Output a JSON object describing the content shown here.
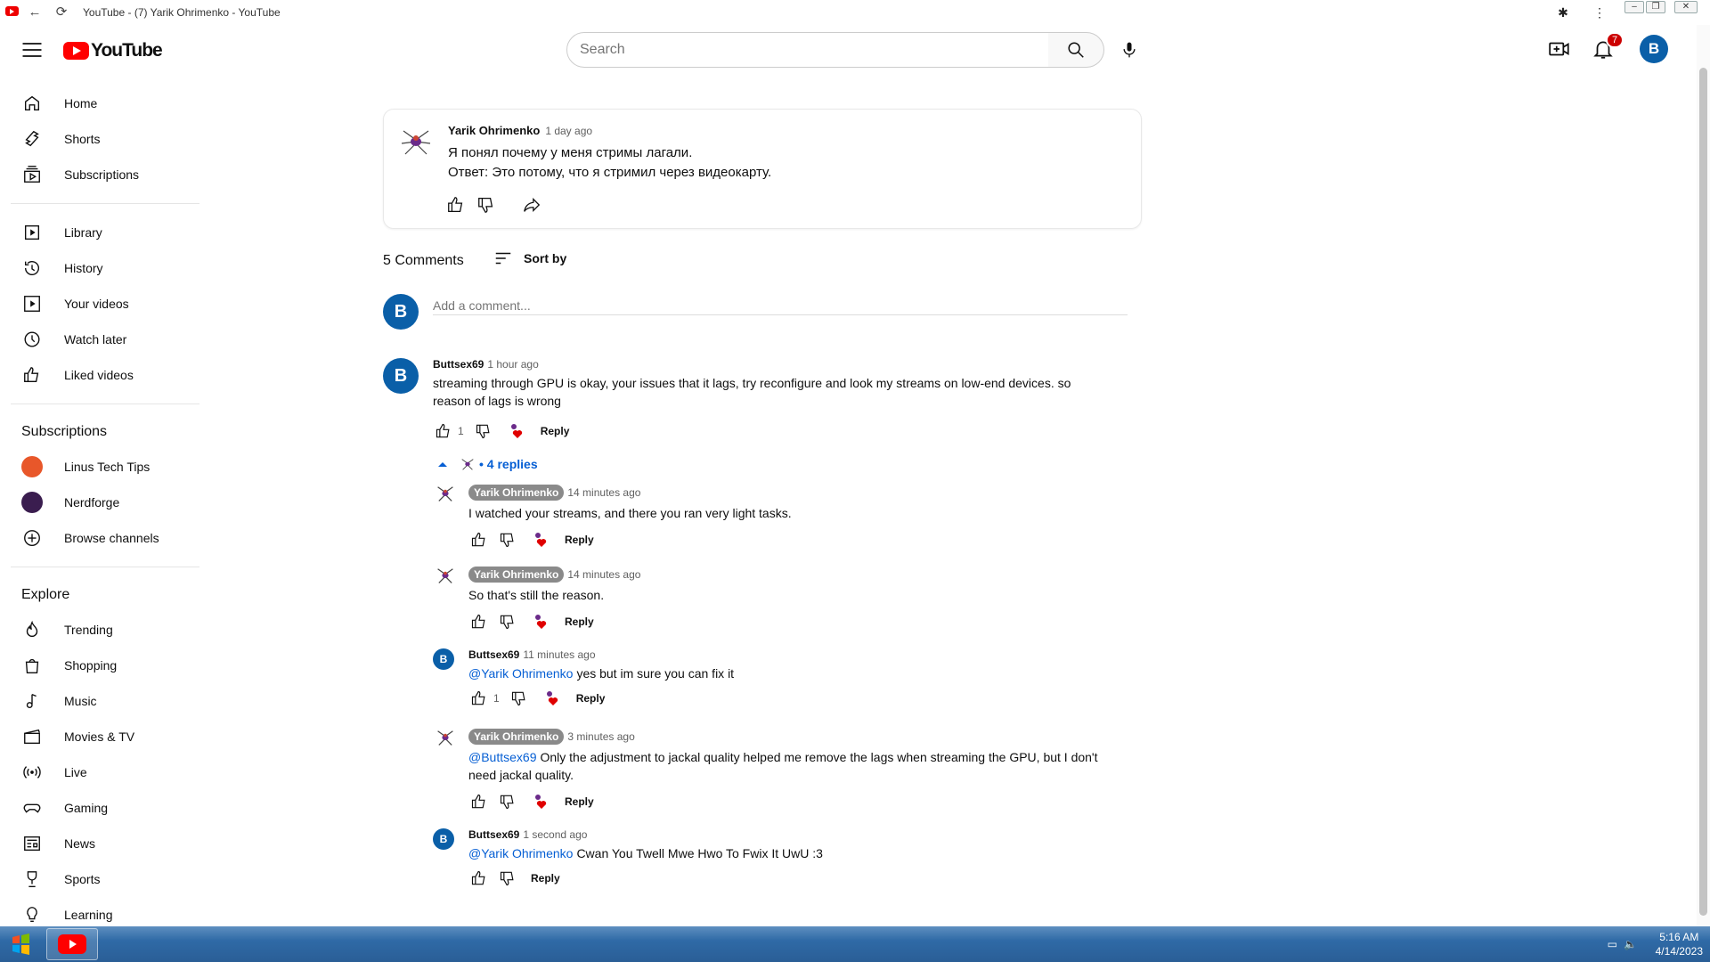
{
  "window": {
    "title": "YouTube - (7) Yarik Ohrimenko - YouTube"
  },
  "masthead": {
    "logo_text": "YouTube",
    "search_placeholder": "Search",
    "notification_count": "7",
    "avatar_letter": "B"
  },
  "sidebar": {
    "main": [
      {
        "label": "Home",
        "icon": "home-icon"
      },
      {
        "label": "Shorts",
        "icon": "shorts-icon"
      },
      {
        "label": "Subscriptions",
        "icon": "subscriptions-icon"
      }
    ],
    "library": [
      {
        "label": "Library",
        "icon": "library-icon"
      },
      {
        "label": "History",
        "icon": "history-icon"
      },
      {
        "label": "Your videos",
        "icon": "your-videos-icon"
      },
      {
        "label": "Watch later",
        "icon": "watch-later-icon"
      },
      {
        "label": "Liked videos",
        "icon": "liked-videos-icon"
      }
    ],
    "subscriptions_heading": "Subscriptions",
    "subscriptions": [
      {
        "label": "Linus Tech Tips",
        "color": "#e8572a"
      },
      {
        "label": "Nerdforge",
        "color": "#3a1d4f"
      },
      {
        "label": "Browse channels",
        "icon": "plus-circle-icon"
      }
    ],
    "explore_heading": "Explore",
    "explore": [
      {
        "label": "Trending",
        "icon": "trending-icon"
      },
      {
        "label": "Shopping",
        "icon": "shopping-icon"
      },
      {
        "label": "Music",
        "icon": "music-icon"
      },
      {
        "label": "Movies & TV",
        "icon": "movies-icon"
      },
      {
        "label": "Live",
        "icon": "live-icon"
      },
      {
        "label": "Gaming",
        "icon": "gaming-icon"
      },
      {
        "label": "News",
        "icon": "news-icon"
      },
      {
        "label": "Sports",
        "icon": "sports-icon"
      },
      {
        "label": "Learning",
        "icon": "learning-icon"
      }
    ]
  },
  "post": {
    "author": "Yarik Ohrimenko",
    "time": "1 day ago",
    "line1": "Я понял почему у меня стримы лагали.",
    "line2": "Ответ: Это потому, что я стримил через видеокарту."
  },
  "comments_header": {
    "count": "5 Comments",
    "sort_label": "Sort by",
    "add_placeholder": "Add a comment...",
    "avatar_letter": "B"
  },
  "top_comment": {
    "author": "Buttsex69",
    "time": "1 hour ago",
    "text_line1": "streaming through GPU is okay, your issues that it lags, try reconfigure and look my streams on low-end devices. so",
    "text_line2": "reason of lags is wrong",
    "likes": "1",
    "reply_label": "Reply",
    "replies_toggle": "• 4 replies"
  },
  "replies": [
    {
      "author": "Yarik Ohrimenko",
      "time": "14 minutes ago",
      "text": "I watched your streams, and there you ran very light tasks.",
      "reply_label": "Reply"
    },
    {
      "author": "Yarik Ohrimenko",
      "time": "14 minutes ago",
      "text": "So that's still the reason.",
      "reply_label": "Reply"
    },
    {
      "author": "Buttsex69",
      "time": "11 minutes ago",
      "mention": "@Yarik Ohrimenko",
      "text": "yes but im sure you can fix it",
      "likes": "1",
      "reply_label": "Reply"
    },
    {
      "author": "Yarik Ohrimenko",
      "time": "3 minutes ago",
      "mention": "@Buttsex69",
      "text_line1": "Only the adjustment to jackal quality helped me remove the lags when streaming the GPU, but I don't",
      "text_line2": "need jackal quality.",
      "reply_label": "Reply"
    },
    {
      "author": "Buttsex69",
      "time": "1 second ago",
      "mention": "@Yarik Ohrimenko",
      "text": "Cwan You Twell Mwe Hwo To Fwix It UwU :3",
      "reply_label": "Reply"
    }
  ],
  "taskbar": {
    "time": "5:16 AM",
    "date": "4/14/2023"
  },
  "colors": {
    "brand_red": "#ff0000",
    "link_blue": "#065fd4",
    "avatar_blue": "#0a5fa8",
    "heart_red": "#e00000"
  }
}
